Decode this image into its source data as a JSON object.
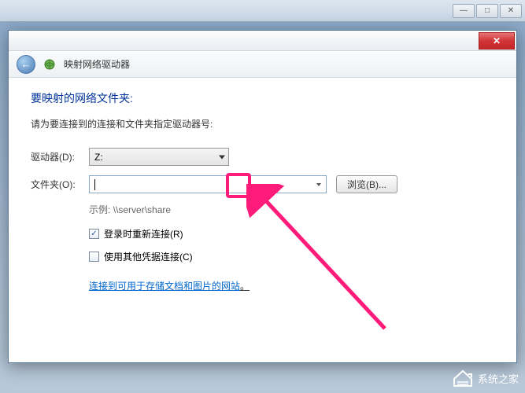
{
  "outer_window": {
    "minimize": "—",
    "maximize": "□",
    "close": "✕"
  },
  "dialog": {
    "close": "✕",
    "back_arrow": "←",
    "title": "映射网络驱动器"
  },
  "content": {
    "heading": "要映射的网络文件夹:",
    "instruction": "请为要连接到的连接和文件夹指定驱动器号:",
    "drive_label": "驱动器(D):",
    "drive_value": "Z:",
    "folder_label": "文件夹(O):",
    "folder_value": "",
    "browse_label": "浏览(B)...",
    "example_label": "示例:",
    "example_value": "\\\\server\\share",
    "reconnect_label": "登录时重新连接(R)",
    "other_creds_label": "使用其他凭据连接(C)",
    "link_text": "连接到可用于存储文档和图片的网站",
    "link_period": "。"
  },
  "watermark": {
    "text": "系统之家"
  }
}
